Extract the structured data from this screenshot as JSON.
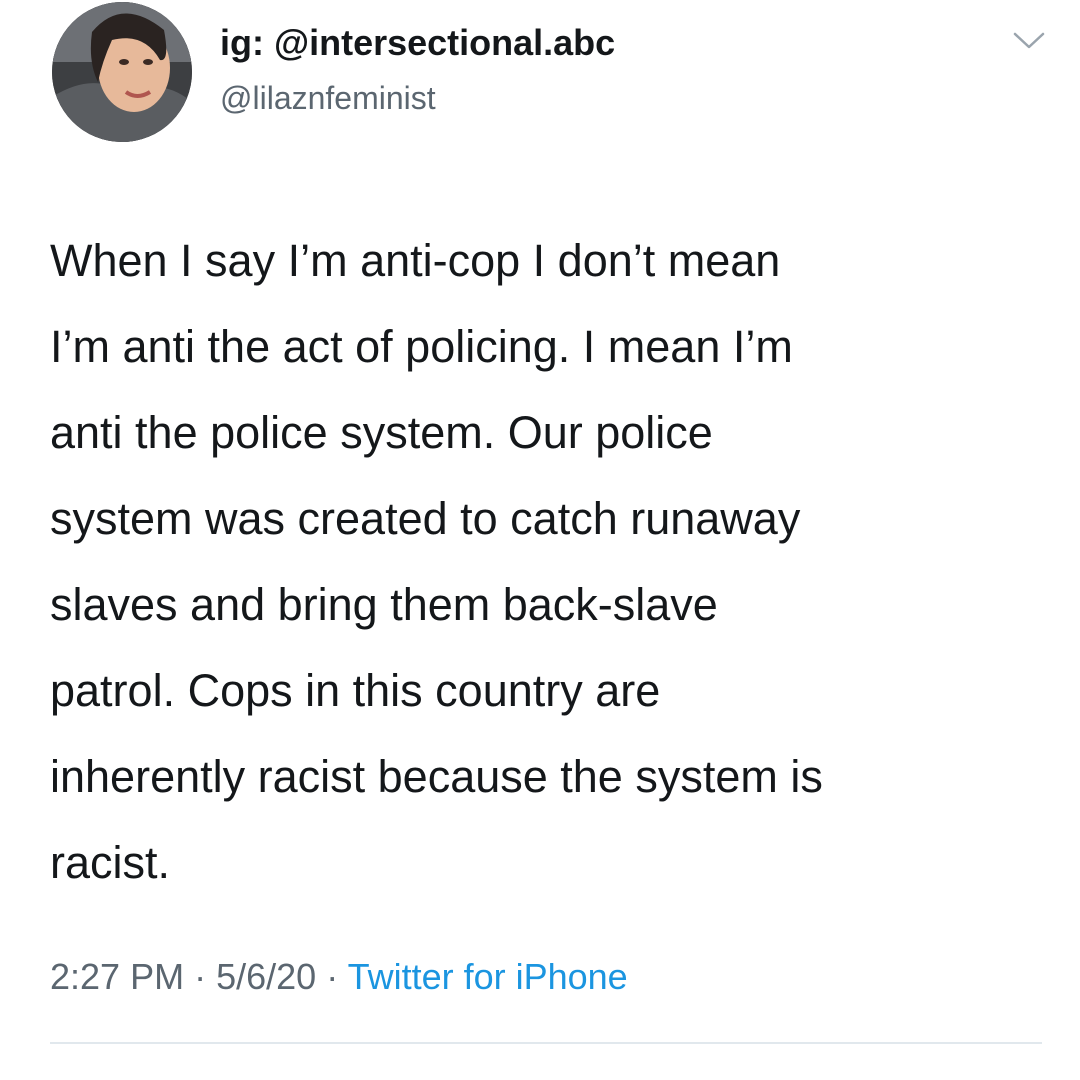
{
  "tweet": {
    "display_name": "ig: @intersectional.abc",
    "handle": "@lilaznfeminist",
    "text_lines": [
      "When I say I’m anti-cop I don’t mean",
      "I’m anti the act of policing. I mean I’m",
      "anti the police system. Our police",
      "system was created to catch runaway",
      "slaves and bring them back-slave",
      "patrol. Cops in this country are",
      "inherently racist because the system is",
      "racist."
    ],
    "time": "2:27 PM",
    "separator": "·",
    "date": "5/6/20",
    "source": "Twitter for iPhone",
    "menu_icon": "chevron-down-icon"
  },
  "colors": {
    "text": "#14171a",
    "secondary": "#5b6670",
    "link": "#1b95e0",
    "divider": "#e1e8ed"
  }
}
